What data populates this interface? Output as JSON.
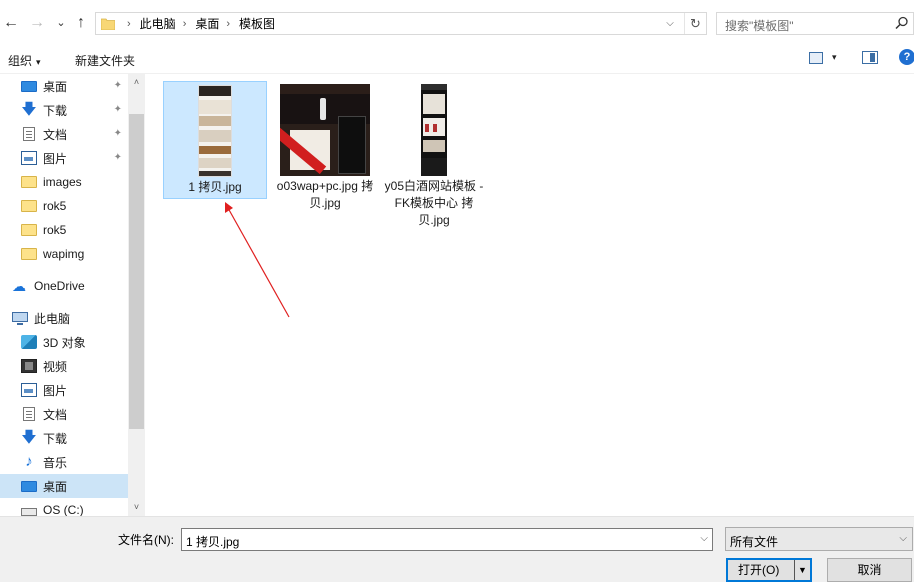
{
  "nav": {
    "back_icon": "←",
    "forward_icon": "→",
    "recent_icon": "⌄",
    "up_icon": "↑"
  },
  "address": {
    "crumbs": [
      "此电脑",
      "桌面",
      "模板图"
    ],
    "separator": "›",
    "dropdown_icon": "⌵",
    "refresh_icon": "↻"
  },
  "search": {
    "placeholder": "搜索\"模板图\""
  },
  "toolbar": {
    "organize_label": "组织",
    "organize_caret": "▾",
    "new_folder_label": "新建文件夹",
    "view_caret": "▾",
    "help_label": "?"
  },
  "sidebar": {
    "items": [
      {
        "label": "桌面",
        "icon": "desktop-icon",
        "pinned": true
      },
      {
        "label": "下载",
        "icon": "download-icon",
        "pinned": true
      },
      {
        "label": "文档",
        "icon": "document-icon",
        "pinned": true
      },
      {
        "label": "图片",
        "icon": "picture-icon",
        "pinned": true
      },
      {
        "label": "images",
        "icon": "folder-icon"
      },
      {
        "label": "rok5",
        "icon": "folder-icon"
      },
      {
        "label": "rok5",
        "icon": "folder-icon"
      },
      {
        "label": "wapimg",
        "icon": "folder-icon"
      },
      {
        "label": "OneDrive",
        "icon": "cloud-icon"
      },
      {
        "label": "此电脑",
        "icon": "computer-icon"
      },
      {
        "label": "3D 对象",
        "icon": "3d-objects-icon"
      },
      {
        "label": "视频",
        "icon": "video-icon"
      },
      {
        "label": "图片",
        "icon": "picture-icon"
      },
      {
        "label": "文档",
        "icon": "document-icon"
      },
      {
        "label": "下载",
        "icon": "download-icon"
      },
      {
        "label": "音乐",
        "icon": "music-icon"
      },
      {
        "label": "桌面",
        "icon": "desktop-icon",
        "selected": true
      },
      {
        "label": "OS (C:)",
        "icon": "drive-icon"
      }
    ],
    "pin_glyph": "📌",
    "scroll_up": "˄",
    "scroll_down": "˅"
  },
  "files": [
    {
      "name": "1 拷贝.jpg",
      "selected": true
    },
    {
      "name": "o03wap+pc.jpg 拷贝.jpg"
    },
    {
      "name": "y05白酒网站模板 - FK模板中心 拷贝.jpg"
    }
  ],
  "bottom": {
    "filename_label": "文件名(N):",
    "filename_value": "1 拷贝.jpg",
    "filter_value": "所有文件",
    "open_label": "打开(O)",
    "cancel_label": "取消",
    "dropdown_icon": "⌵"
  },
  "colors": {
    "selection": "#cce8ff",
    "accent": "#0078d7",
    "arrow": "#e02020"
  }
}
